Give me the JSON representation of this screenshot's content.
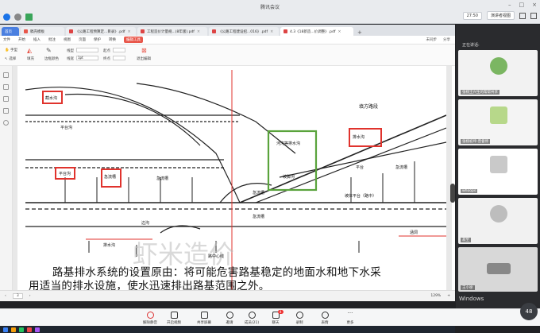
{
  "meeting": {
    "title": "腾讯会议",
    "time": "27:50",
    "view_button": "演讲者视图",
    "speaking_label": "正在讲话:"
  },
  "tabs": [
    {
      "label": "首页"
    },
    {
      "label": "稿壳模板"
    },
    {
      "label": "《公路工程预算定...目录》.pdf"
    },
    {
      "label": "工程造价计量规...(8年版).pdf"
    },
    {
      "label": "《公路工程建设招...016》.pdf"
    },
    {
      "label": "4.3《18新造...价调整》.pdf"
    }
  ],
  "menu": {
    "items": [
      "文件",
      "开始",
      "插入",
      "批注",
      "视图",
      "页面",
      "保护",
      "转换",
      "编辑工具"
    ],
    "active_index": 8,
    "right": [
      "未同步",
      "分享"
    ]
  },
  "toolbar": {
    "hand": "手型",
    "select": "选择",
    "fill": "填充",
    "border_color": "边框颜色",
    "line_type_label": "线型",
    "line_width_label": "线宽",
    "line_width_value": "1pt",
    "start_label": "起点",
    "end_label": "终点",
    "exit_edit": "退出编辑"
  },
  "drawing": {
    "labels": [
      "截水沟",
      "平台沟",
      "平台沟",
      "急流槽",
      "急流槽",
      "边沟",
      "排水沟",
      "河沟等排水沟",
      "坡脚沟",
      "坡体平台（路中）",
      "填方路段",
      "急流槽",
      "急流槽",
      "路中心线",
      "平台",
      "急流槽",
      "排水沟",
      "涵洞"
    ],
    "watermark": "虾米造价",
    "caption_line1": "路基排水系统的设置原由：将可能危害路基稳定的地面水和地下水采",
    "caption_line2": "用适当的排水设施，使水迅速排出路基范围之外。"
  },
  "status": {
    "page": "3",
    "zoom": "129%"
  },
  "participants": [
    {
      "name": "张栩王兴生的帮帮共享"
    },
    {
      "name": "张栩初坪-曾督停"
    },
    {
      "name": "whoops"
    },
    {
      "name": "菽至"
    },
    {
      "name": "王小徐"
    }
  ],
  "bottom_bar": [
    "解除静音",
    "开启视频",
    "共享屏幕",
    "邀请",
    "成员(21)",
    "聊天",
    "录制",
    "表情",
    "更多"
  ],
  "chat_badge": "4",
  "speed": "48",
  "activate_text": "Windows",
  "colors": {
    "accent": "#e8564a",
    "highlight_red": "#e0332d",
    "highlight_green": "#5aa33c",
    "tab_blue": "#4a7fe0"
  }
}
